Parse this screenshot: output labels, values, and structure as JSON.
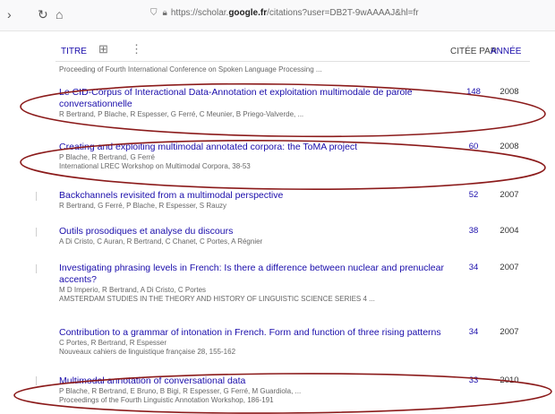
{
  "browser": {
    "url_prefix": "https://scholar.",
    "url_domain": "google.fr",
    "url_suffix": "/citations?user=DB2T-9wAAAAJ&hl=fr"
  },
  "columns": {
    "title": "TITRE",
    "cited_by": "CITÉE PAR",
    "year": "ANNÉE"
  },
  "top_venue": "Proceeding of Fourth International Conference on Spoken Language Processing ...",
  "articles": [
    {
      "title": "Le CID-Corpus of Interactional Data-Annotation et exploitation multimodale de parole conversationnelle",
      "authors": "R Bertrand, P Blache, R Espesser, G Ferré, C Meunier, B Priego-Valverde, ...",
      "venue": "",
      "cited": "148",
      "year": "2008"
    },
    {
      "title": "Creating and exploiting multimodal annotated corpora: the ToMA project",
      "authors": "P Blache, R Bertrand, G Ferré",
      "venue": "International LREC Workshop on Multimodal Corpora, 38-53",
      "cited": "60",
      "year": "2008"
    },
    {
      "title": "Backchannels revisited from a multimodal perspective",
      "authors": "R Bertrand, G Ferré, P Blache, R Espesser, S Rauzy",
      "venue": "",
      "cited": "52",
      "year": "2007"
    },
    {
      "title": "Outils prosodiques et analyse du discours",
      "authors": "A Di Cristo, C Auran, R Bertrand, C Chanet, C Portes, A Régnier",
      "venue": "",
      "cited": "38",
      "year": "2004"
    },
    {
      "title": "Investigating phrasing levels in French: Is there a difference between nuclear and prenuclear accents?",
      "authors": "M D Imperio, R Bertrand, A Di Cristo, C Portes",
      "venue": "AMSTERDAM STUDIES IN THE THEORY AND HISTORY OF LINGUISTIC SCIENCE SERIES 4 ...",
      "cited": "34",
      "year": "2007"
    },
    {
      "title": "Contribution to a grammar of intonation in French. Form and function of three rising patterns",
      "authors": "C Portes, R Bertrand, R Espesser",
      "venue": "Nouveaux cahiers de linguistique française 28, 155-162",
      "cited": "34",
      "year": "2007"
    },
    {
      "title": "Multimodal annotation of conversational data",
      "authors": "P Blache, R Bertrand, E Bruno, B Bigi, R Espesser, G Ferré, M Guardiola, ...",
      "venue": "Proceedings of the Fourth Linguistic Annotation Workshop, 186-191",
      "cited": "33",
      "year": "2010"
    }
  ],
  "annotation_color": "#8b1a1a"
}
